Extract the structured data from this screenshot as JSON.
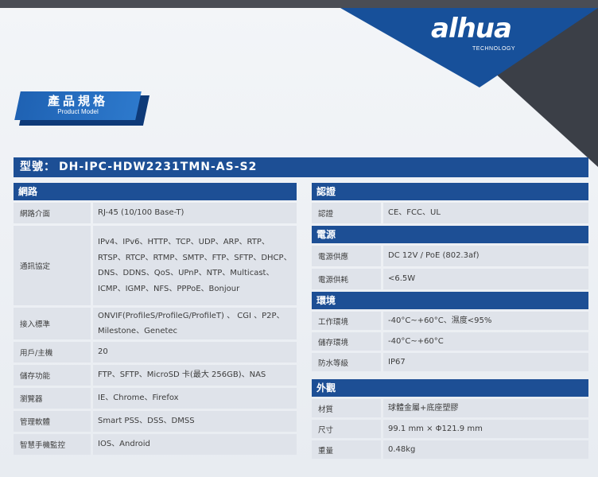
{
  "brand": {
    "logo": "alhua",
    "tagline": "TECHNOLOGY",
    "accent": "#1d4f95",
    "dark": "#3b3f47"
  },
  "ribbon": {
    "title": "產品規格",
    "subtitle": "Product Model"
  },
  "model": {
    "label": "型號：",
    "value": "DH-IPC-HDW2231TMN-AS-S2"
  },
  "network": {
    "title": "網路",
    "rows": [
      {
        "key": "網路介面",
        "value": "RJ-45 (10/100 Base-T)"
      },
      {
        "key": "通訊協定",
        "value": "IPv4、IPv6、HTTP、TCP、UDP、ARP、RTP、RTSP、RTCP、RTMP、SMTP、FTP、SFTP、DHCP、DNS、DDNS、QoS、UPnP、NTP、Multicast、ICMP、IGMP、NFS、PPPoE、Bonjour"
      },
      {
        "key": "接入標準",
        "value": "ONVIF(ProfileS/ProfileG/ProfileT) 、 CGI 、P2P、Milestone、Genetec"
      },
      {
        "key": "用戶/主機",
        "value": "20"
      },
      {
        "key": "儲存功能",
        "value": "FTP、SFTP、MicroSD 卡(最大 256GB)、NAS"
      },
      {
        "key": "瀏覽器",
        "value": "IE、Chrome、Firefox"
      },
      {
        "key": "管理軟體",
        "value": "Smart PSS、DSS、DMSS"
      },
      {
        "key": "智慧手機監控",
        "value": "IOS、Android"
      }
    ]
  },
  "certification": {
    "title": "認證",
    "rows": [
      {
        "key": "認證",
        "value": "CE、FCC、UL"
      }
    ]
  },
  "power": {
    "title": "電源",
    "rows": [
      {
        "key": "電源供應",
        "value": "DC 12V / PoE (802.3af)"
      },
      {
        "key": "電源供耗",
        "value": "<6.5W"
      }
    ]
  },
  "environment": {
    "title": "環境",
    "rows": [
      {
        "key": "工作環境",
        "value": "-40°C~+60°C、濕度<95%"
      },
      {
        "key": "儲存環境",
        "value": "-40°C~+60°C"
      },
      {
        "key": "防水等級",
        "value": "IP67"
      }
    ]
  },
  "appearance": {
    "title": "外觀",
    "rows": [
      {
        "key": "材質",
        "value": "球體金屬+底座塑膠"
      },
      {
        "key": "尺寸",
        "value": "99.1 mm × Φ121.9 mm"
      },
      {
        "key": "重量",
        "value": "0.48kg"
      }
    ]
  }
}
